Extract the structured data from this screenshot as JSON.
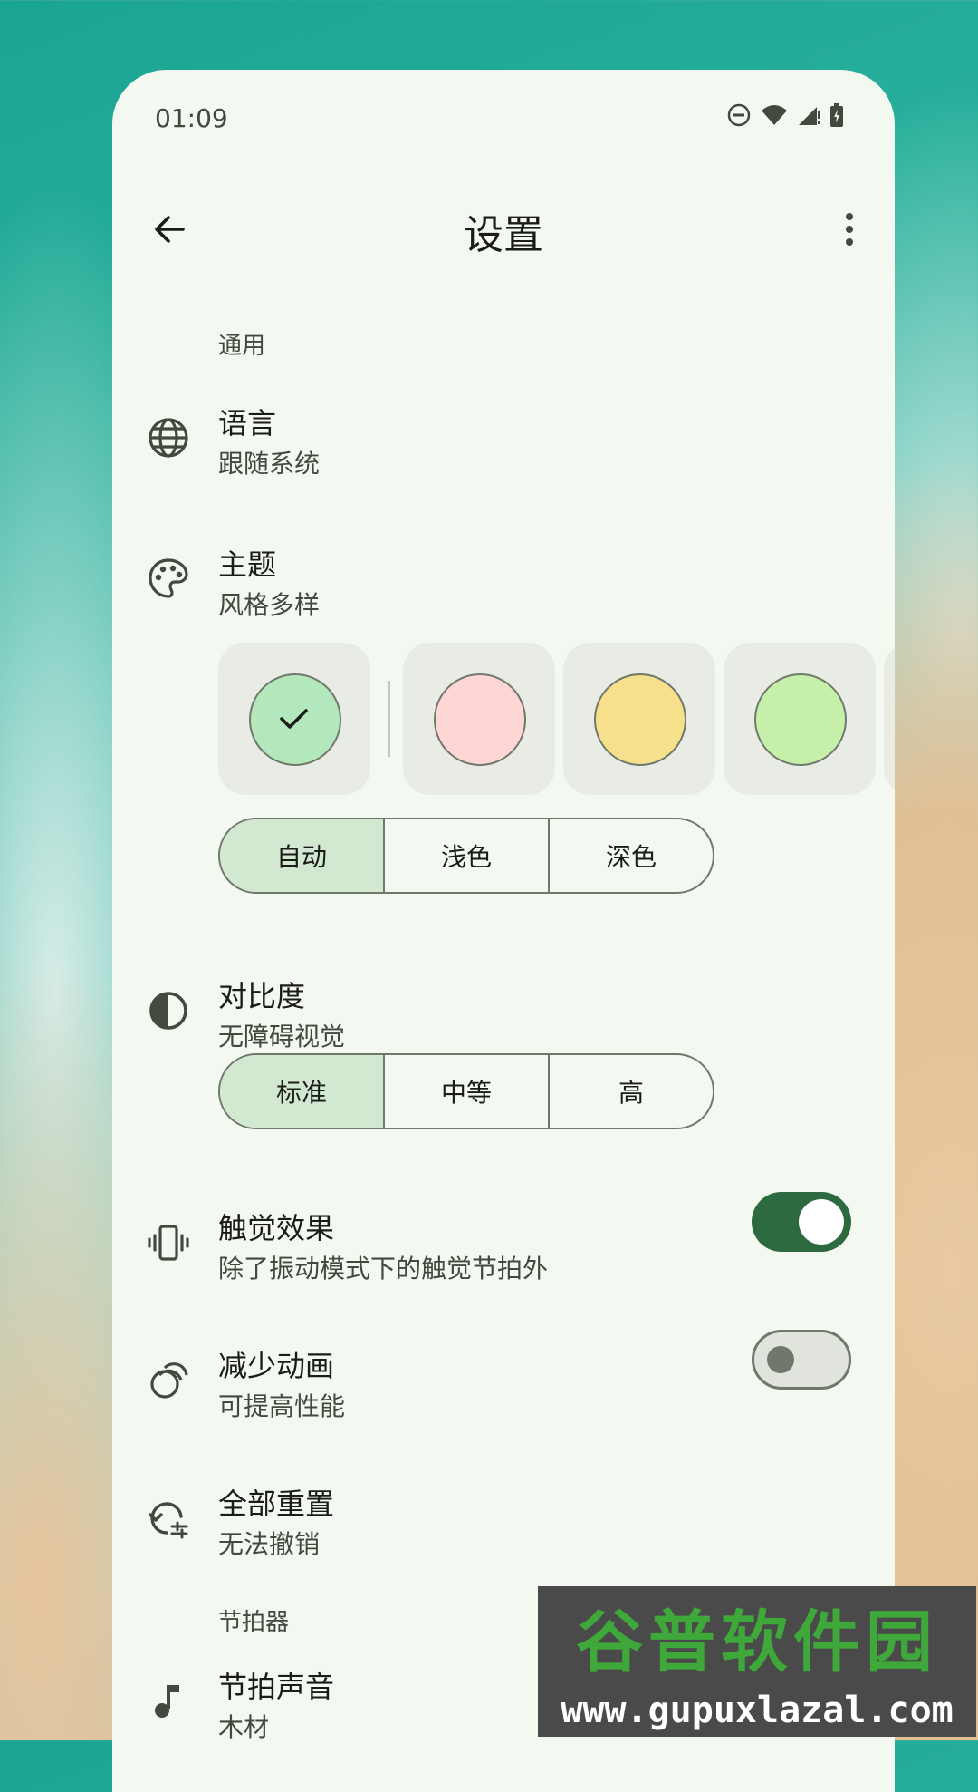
{
  "status_bar": {
    "time": "01:09",
    "icons": [
      "dnd-icon",
      "wifi-icon",
      "signal-icon",
      "battery-charging-icon"
    ]
  },
  "app_bar": {
    "title": "设置",
    "back_icon": "arrow-back-icon",
    "more_icon": "more-vert-icon"
  },
  "sections": {
    "general": "通用",
    "metronome": "节拍器"
  },
  "language": {
    "title": "语言",
    "subtitle": "跟随系统",
    "icon": "globe-icon"
  },
  "theme": {
    "title": "主题",
    "subtitle": "风格多样",
    "icon": "palette-icon",
    "swatches": [
      {
        "color": "#b3e8bd",
        "selected": true
      },
      {
        "color": "#ffd6d6",
        "selected": false
      },
      {
        "color": "#f7e08c",
        "selected": false
      },
      {
        "color": "#c6efaa",
        "selected": false
      }
    ],
    "mode": {
      "options": [
        "自动",
        "浅色",
        "深色"
      ],
      "selected": "自动"
    }
  },
  "contrast": {
    "title": "对比度",
    "subtitle": "无障碍视觉",
    "icon": "contrast-icon",
    "options": [
      "标准",
      "中等",
      "高"
    ],
    "selected": "标准"
  },
  "haptics": {
    "title": "触觉效果",
    "subtitle": "除了振动模式下的触觉节拍外",
    "icon": "vibration-icon",
    "enabled": true
  },
  "reduce_animations": {
    "title": "减少动画",
    "subtitle": "可提高性能",
    "icon": "animation-icon",
    "enabled": false
  },
  "reset": {
    "title": "全部重置",
    "subtitle": "无法撤销",
    "icon": "reset-settings-icon"
  },
  "beat_sound": {
    "title": "节拍声音",
    "subtitle": "木材",
    "icon": "music-note-icon"
  },
  "watermark": {
    "title": "谷普软件园",
    "url": "www.gupuxlazal.com"
  },
  "colors": {
    "accent": "#2d6a3f",
    "surface": "#f3f8f0",
    "selected_segment": "#d3e8d1"
  }
}
